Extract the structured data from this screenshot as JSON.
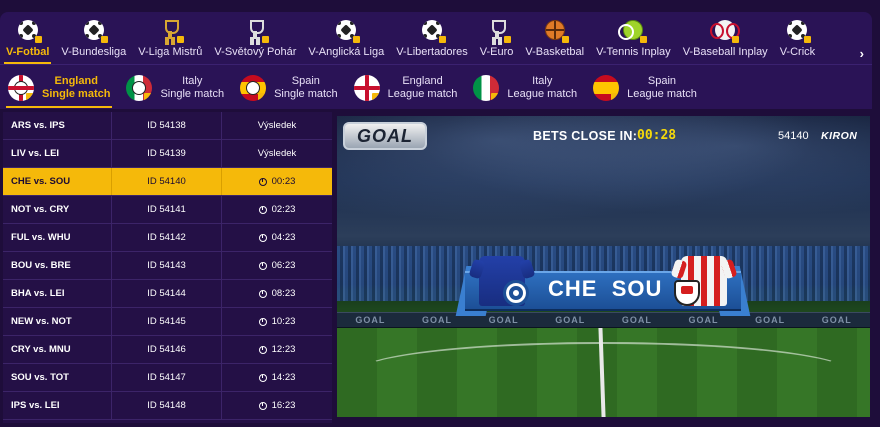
{
  "sports": [
    {
      "label": "V-Fotbal",
      "icon": "soccer-ball-icon",
      "active": true
    },
    {
      "label": "V-Bundesliga",
      "icon": "soccer-ball-icon"
    },
    {
      "label": "V-Liga Mistrů",
      "icon": "trophy-icon"
    },
    {
      "label": "V-Světový Pohár",
      "icon": "trophy-icon"
    },
    {
      "label": "V-Anglická Liga",
      "icon": "soccer-ball-icon"
    },
    {
      "label": "V-Libertadores",
      "icon": "soccer-ball-icon"
    },
    {
      "label": "V-Euro",
      "icon": "trophy-icon"
    },
    {
      "label": "V-Basketbal",
      "icon": "basketball-icon"
    },
    {
      "label": "V-Tennis Inplay",
      "icon": "tennis-ball-icon"
    },
    {
      "label": "V-Baseball Inplay",
      "icon": "baseball-icon"
    },
    {
      "label": "V-Crick",
      "icon": "cricket-ball-icon"
    }
  ],
  "competitions": [
    {
      "line1": "England",
      "line2": "Single match",
      "flag": "england-flag-icon",
      "active": true
    },
    {
      "line1": "Italy",
      "line2": "Single match",
      "flag": "italy-flag-icon"
    },
    {
      "line1": "Spain",
      "line2": "Single match",
      "flag": "spain-flag-icon"
    },
    {
      "line1": "England",
      "line2": "League match",
      "flag": "england-flag-icon"
    },
    {
      "line1": "Italy",
      "line2": "League match",
      "flag": "italy-flag-icon"
    },
    {
      "line1": "Spain",
      "line2": "League match",
      "flag": "spain-flag-icon"
    }
  ],
  "matches": [
    {
      "teams": "ARS vs. IPS",
      "id": "ID 54138",
      "status": "Výsledek"
    },
    {
      "teams": "LIV vs. LEI",
      "id": "ID 54139",
      "status": "Výsledek"
    },
    {
      "teams": "CHE vs. SOU",
      "id": "ID 54140",
      "status": "00:23",
      "active": true
    },
    {
      "teams": "NOT vs. CRY",
      "id": "ID 54141",
      "status": "02:23"
    },
    {
      "teams": "FUL vs. WHU",
      "id": "ID 54142",
      "status": "04:23"
    },
    {
      "teams": "BOU vs. BRE",
      "id": "ID 54143",
      "status": "06:23"
    },
    {
      "teams": "BHA vs. LEI",
      "id": "ID 54144",
      "status": "08:23"
    },
    {
      "teams": "NEW vs. NOT",
      "id": "ID 54145",
      "status": "10:23"
    },
    {
      "teams": "CRY vs. MNU",
      "id": "ID 54146",
      "status": "12:23"
    },
    {
      "teams": "SOU vs. TOT",
      "id": "ID 54147",
      "status": "14:23"
    },
    {
      "teams": "IPS vs. LEI",
      "id": "ID 54148",
      "status": "16:23"
    }
  ],
  "video": {
    "logo": "GOAL",
    "bets_label": "BETS CLOSE IN:",
    "countdown": "00:28",
    "event_id": "54140",
    "provider": "KIRON",
    "home_team": "CHE",
    "away_team": "SOU",
    "hoarding": "GOAL"
  },
  "colors": {
    "accent": "#f5b90a",
    "panel": "#2a1356",
    "background": "#1e0d3a"
  }
}
